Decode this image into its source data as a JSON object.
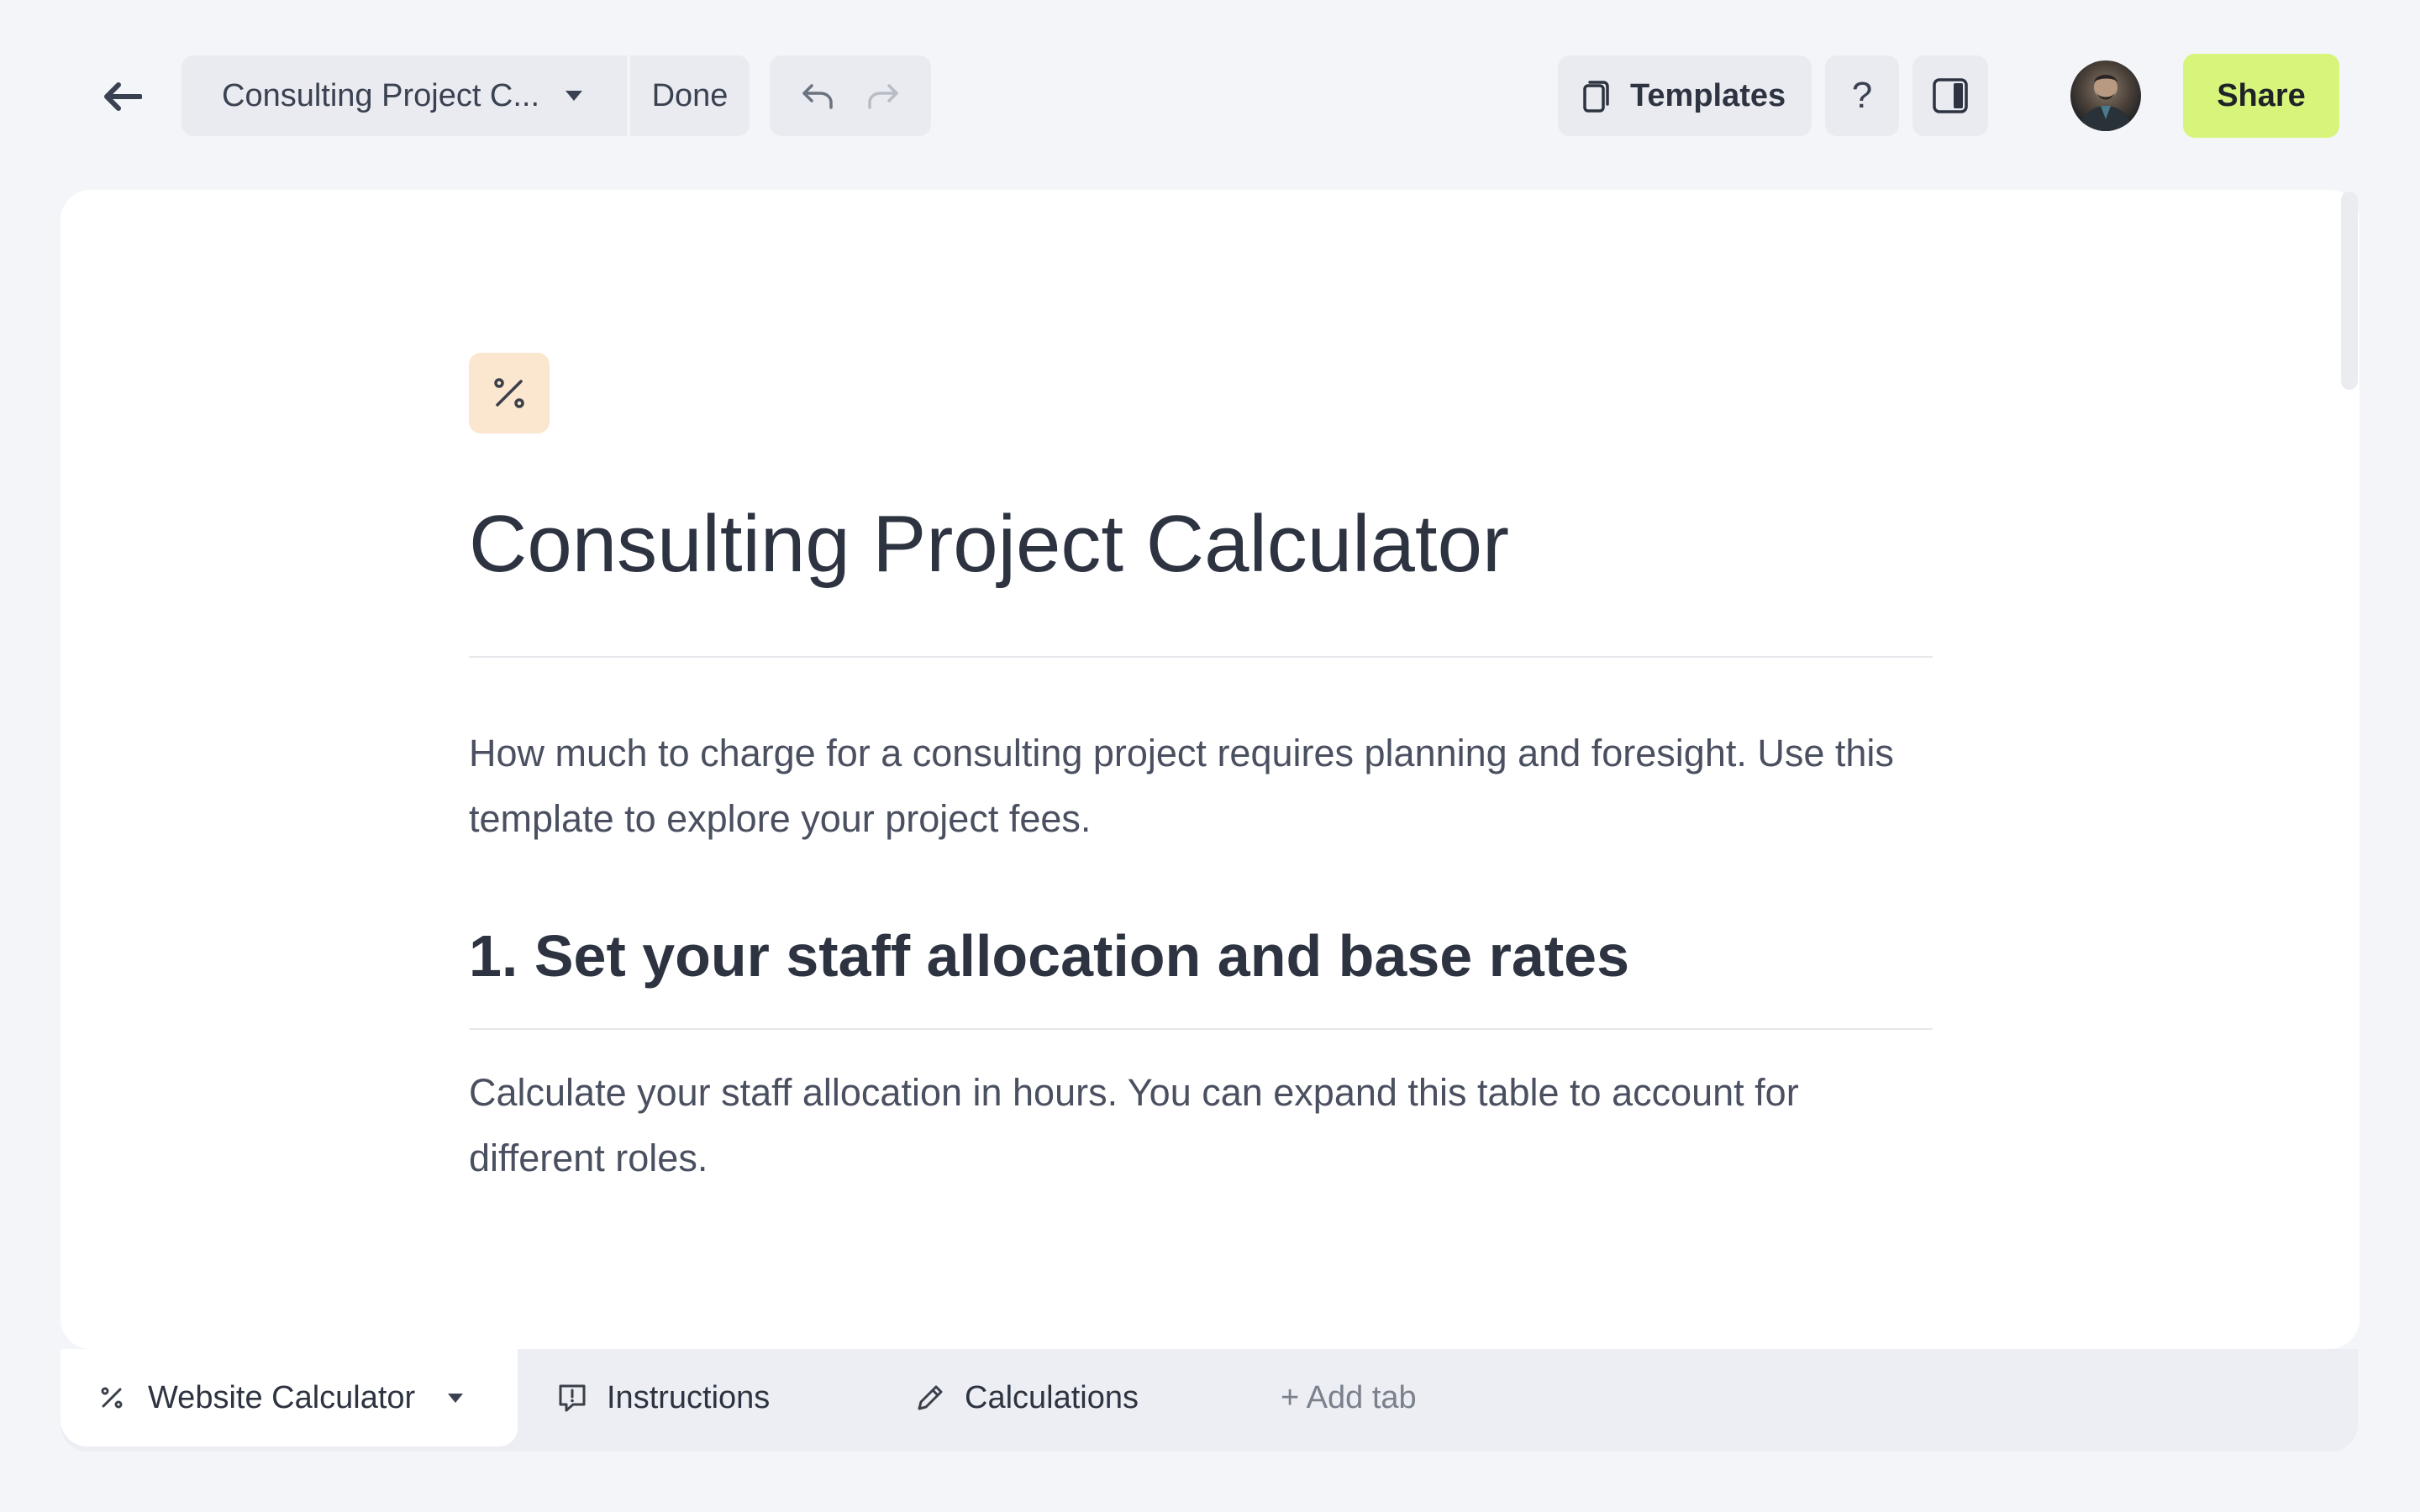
{
  "topbar": {
    "doc_name": "Consulting Project C...",
    "done_label": "Done",
    "templates_label": "Templates",
    "help_label": "?",
    "share_label": "Share"
  },
  "document": {
    "title": "Consulting Project Calculator",
    "intro": "How much to charge for a consulting project requires planning and foresight. Use this template to explore your project fees.",
    "section1_heading": "1. Set your staff allocation and base rates",
    "section1_body": "Calculate your staff allocation in hours. You can expand this table to account for different roles."
  },
  "tabs": {
    "active_label": "Website Calculator",
    "items": [
      {
        "label": "Instructions",
        "icon": "comment-alert-icon"
      },
      {
        "label": "Calculations",
        "icon": "pencil-icon"
      }
    ],
    "add_label": "+ Add tab"
  },
  "colors": {
    "accent_share": "#d7f57a",
    "doc_icon_bg": "#fbe6cf",
    "page_bg": "#f4f5f8"
  }
}
